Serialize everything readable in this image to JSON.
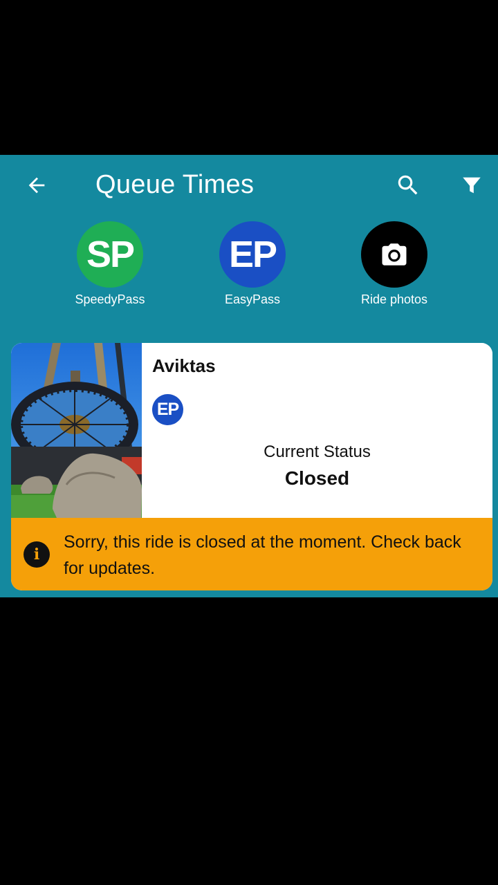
{
  "header": {
    "title": "Queue Times",
    "back_icon": "arrow-left-icon",
    "search_icon": "search-icon",
    "filter_icon": "filter-icon"
  },
  "quick_actions": [
    {
      "abbr": "SP",
      "label": "SpeedyPass",
      "color": "#1fae55"
    },
    {
      "abbr": "EP",
      "label": "EasyPass",
      "color": "#1a4fc4"
    },
    {
      "abbr": "",
      "label": "Ride photos",
      "color": "#000000",
      "icon": "camera-icon"
    }
  ],
  "ride": {
    "name": "Aviktas",
    "badge": "EP",
    "status_label": "Current Status",
    "status_value": "Closed",
    "notice": "Sorry, this ride is closed at the moment. Check back for updates.",
    "notice_icon": "info-icon"
  },
  "colors": {
    "app_background": "#14899f",
    "notice_background": "#f5a009",
    "card_background": "#ffffff"
  }
}
